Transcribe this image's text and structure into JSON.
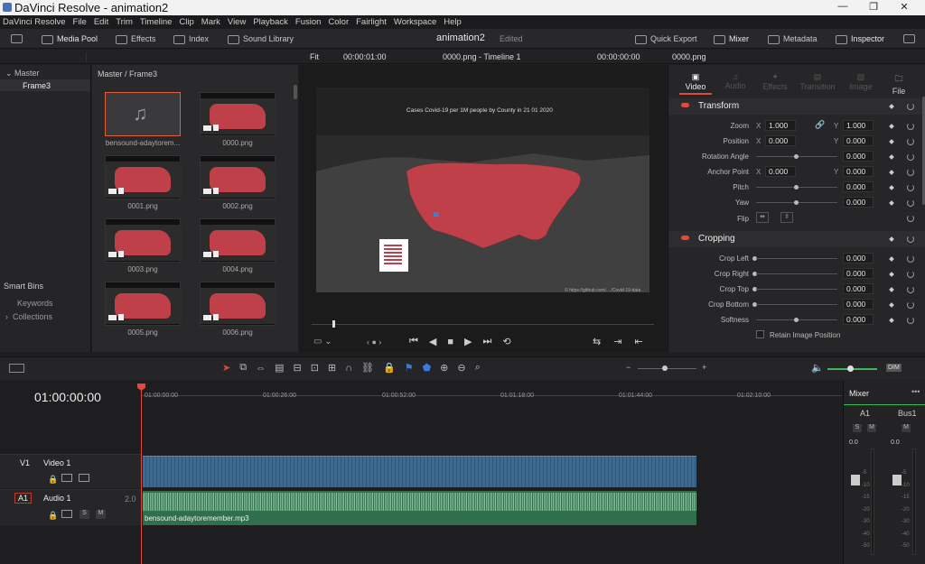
{
  "window": {
    "title": "DaVinci Resolve - animation2",
    "controls": [
      "—",
      "❐",
      "✕"
    ]
  },
  "menu": [
    "DaVinci Resolve",
    "File",
    "Edit",
    "Trim",
    "Timeline",
    "Clip",
    "Mark",
    "View",
    "Playback",
    "Fusion",
    "Color",
    "Fairlight",
    "Workspace",
    "Help"
  ],
  "toolbar": {
    "media_pool": "Media Pool",
    "effects": "Effects",
    "index": "Index",
    "sound_library": "Sound Library",
    "project_name": "animation2",
    "project_status": "Edited",
    "quick_export": "Quick Export",
    "mixer": "Mixer",
    "metadata": "Metadata",
    "inspector": "Inspector"
  },
  "viewer_bar": {
    "fit": "Fit",
    "timecode_left": "00:00:01:00",
    "clip_title": "0000.png - Timeline 1",
    "timecode_right": "00:00:00:00",
    "inspector_clip": "0000.png"
  },
  "bins": {
    "master": "Master",
    "frame3": "Frame3",
    "smart_bins": "Smart Bins",
    "keywords": "Keywords",
    "collections": "Collections"
  },
  "media_pool": {
    "path": "Master / Frame3",
    "clips": [
      "bensound-adaytorem...",
      "0000.png",
      "0001.png",
      "0002.png",
      "0003.png",
      "0004.png",
      "0005.png",
      "0006.png"
    ]
  },
  "viewer": {
    "map_title": "Cases Covid-19 per 1M people by County in 21 01 2020",
    "credit": "© https://github.com/..../Covid-19-data"
  },
  "inspector": {
    "tabs": [
      "Video",
      "Audio",
      "Effects",
      "Transition",
      "Image",
      "File"
    ],
    "transform": {
      "header": "Transform",
      "zoom_label": "Zoom",
      "zoom_x": "1.000",
      "zoom_y": "1.000",
      "position_label": "Position",
      "position_x": "0.000",
      "position_y": "0.000",
      "rotation_label": "Rotation Angle",
      "rotation": "0.000",
      "anchor_label": "Anchor Point",
      "anchor_x": "0.000",
      "anchor_y": "0.000",
      "pitch_label": "Pitch",
      "pitch": "0.000",
      "yaw_label": "Yaw",
      "yaw": "0.000",
      "flip_label": "Flip"
    },
    "cropping": {
      "header": "Cropping",
      "left_label": "Crop Left",
      "left": "0.000",
      "right_label": "Crop Right",
      "right": "0.000",
      "top_label": "Crop Top",
      "top": "0.000",
      "bottom_label": "Crop Bottom",
      "bottom": "0.000",
      "softness_label": "Softness",
      "softness": "0.000",
      "retain_label": "Retain Image Position"
    },
    "axis_x": "X",
    "axis_y": "Y"
  },
  "timeline": {
    "timecode": "01:00:00:00",
    "ruler": [
      "01:00:00:00",
      "01:00:26:00",
      "01:00:52:00",
      "01:01:18:00",
      "01:01:44:00",
      "01:02:10:00"
    ],
    "video_track_id": "V1",
    "video_track_name": "Video 1",
    "audio_track_id": "A1",
    "audio_track_name": "Audio 1",
    "audio_level": "2.0",
    "audio_clip_name": "bensound-adaytoremember.mp3",
    "dim": "DIM"
  },
  "mixer": {
    "title": "Mixer",
    "ch1": "A1",
    "ch2": "Bus1",
    "s": "S",
    "m": "M",
    "level1": "0.0",
    "level2": "0.0",
    "scale": [
      "-5",
      "-10",
      "-15",
      "-20",
      "-30",
      "-40",
      "-50"
    ]
  },
  "colors": {
    "accent_red": "#e04a3a",
    "video_clip": "#3d6a8e",
    "audio_clip": "#2f6f4e",
    "map_fill": "#c0404a"
  }
}
